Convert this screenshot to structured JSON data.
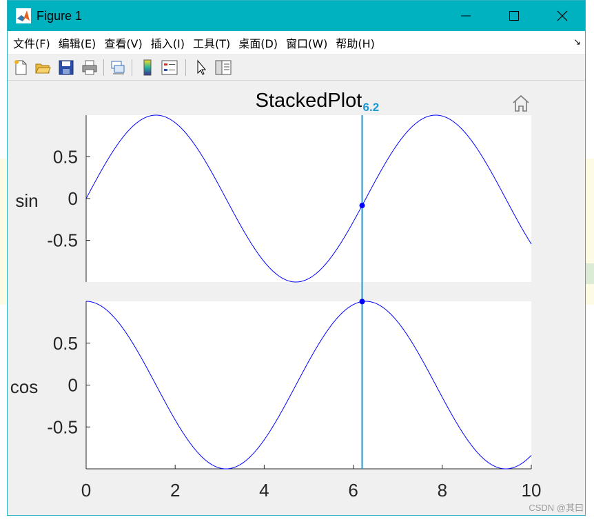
{
  "window": {
    "title": "Figure 1"
  },
  "menu": {
    "items": [
      "文件(F)",
      "编辑(E)",
      "查看(V)",
      "插入(I)",
      "工具(T)",
      "桌面(D)",
      "窗口(W)",
      "帮助(H)"
    ]
  },
  "toolbar": {
    "icons": [
      "new-figure-icon",
      "open-file-icon",
      "save-icon",
      "print-icon",
      "link-plot-icon",
      "colorbar-icon",
      "legend-icon",
      "pointer-icon",
      "property-editor-icon"
    ]
  },
  "figure": {
    "title": "StackedPlot",
    "home_icon": "home-icon"
  },
  "chart_data": {
    "type": "line",
    "title": "StackedPlot",
    "x": {
      "min": 0,
      "max": 10,
      "ticks": [
        0,
        2,
        4,
        6,
        8,
        10
      ],
      "tick_labels": [
        "0",
        "2",
        "4",
        "6",
        "8",
        "10"
      ]
    },
    "cursor": {
      "x": 6.2,
      "label": "6.2",
      "color": "#1c9ad6"
    },
    "panels": [
      {
        "ylabel": "sin",
        "function": "sin",
        "ylim": [
          -1,
          1
        ],
        "yticks": [
          0.5,
          0,
          -0.5
        ],
        "ytick_labels": [
          "0.5",
          "0",
          "-0.5"
        ],
        "line_color": "#0000ff",
        "cursor_marker": {
          "x": 6.2,
          "y": -0.083
        }
      },
      {
        "ylabel": "cos",
        "function": "cos",
        "ylim": [
          -1,
          1
        ],
        "yticks": [
          0.5,
          0,
          -0.5
        ],
        "ytick_labels": [
          "0.5",
          "0",
          "-0.5"
        ],
        "line_color": "#0000ff",
        "cursor_marker": {
          "x": 6.2,
          "y": 0.997
        }
      }
    ]
  },
  "watermark": "CSDN @其曰"
}
